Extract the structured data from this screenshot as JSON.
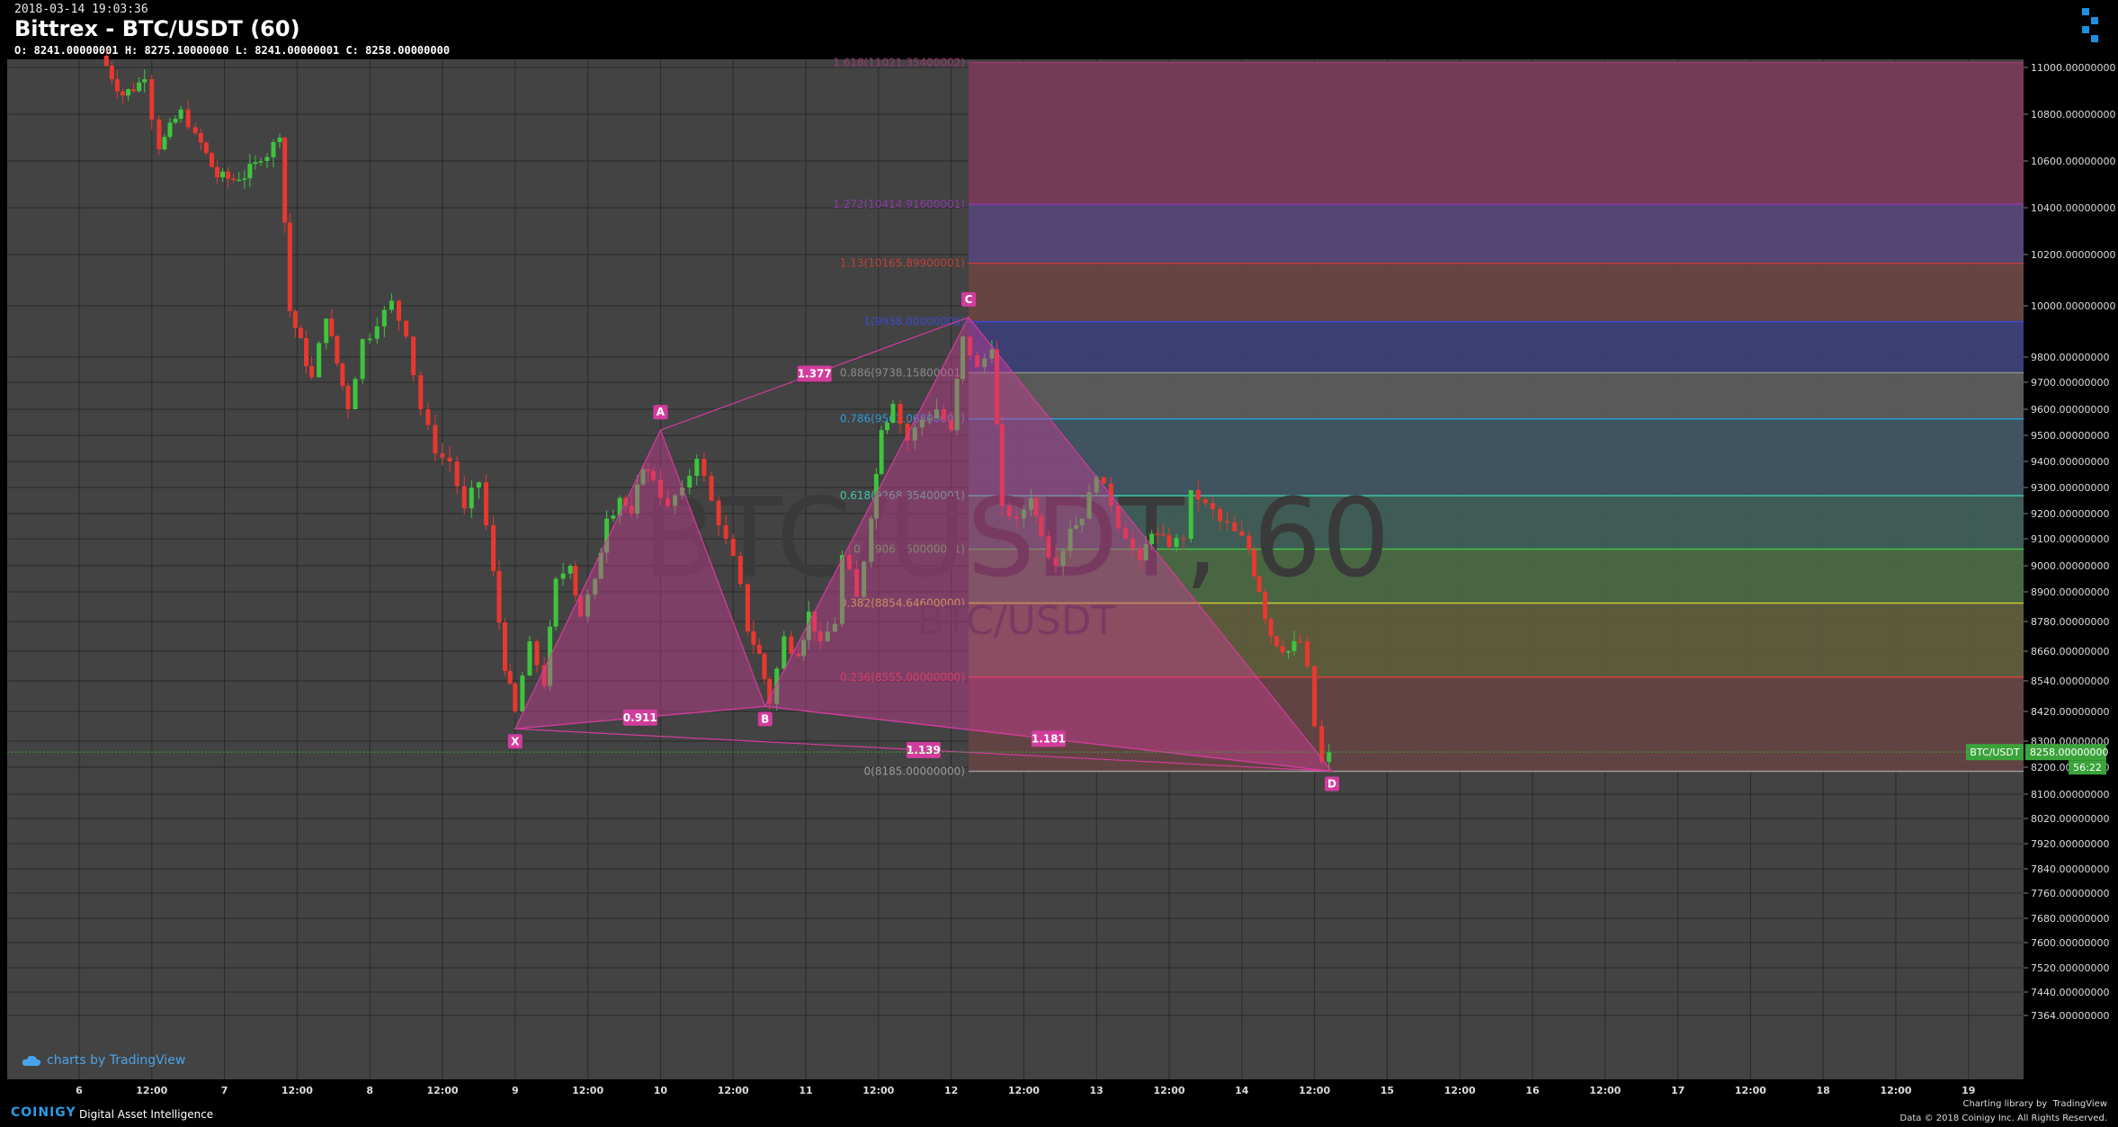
{
  "header": {
    "timestamp": "2018-03-14 19:03:36",
    "title": "Bittrex - BTC/USDT (60)",
    "ohlc": "O: 8241.00000001 H: 8275.10000000 L: 8241.00000001 C: 8258.00000000"
  },
  "watermark": {
    "main": "BTC/USDT, 60",
    "sub": "BTC/USDT"
  },
  "footer": {
    "brand": "COINIGY",
    "tagline": "Digital Asset Intelligence",
    "charting_by": "Charting library by",
    "tradingview": "TradingView",
    "copyright": "Data © 2018  Coinigy Inc. All Rights Reserved."
  },
  "tv_badge": "charts by TradingView",
  "colors": {
    "background": "#434343",
    "grid": "#2a2a2a",
    "up": "#3ec43e",
    "down": "#e8382f",
    "pattern": "#d23c9c",
    "price_tag": "#3aa33a"
  },
  "chart_data": {
    "type": "candlestick",
    "symbol": "BTC/USDT",
    "interval": "60",
    "ylim": [
      7300,
      11050
    ],
    "y_ticks": [
      11000,
      10800,
      10600,
      10400,
      10200,
      10000,
      9800,
      9700,
      9600,
      9500,
      9400,
      9300,
      9200,
      9100,
      9000,
      8900,
      8780,
      8660,
      8540,
      8420,
      8300,
      8200,
      8100,
      8020,
      7920,
      7840,
      7760,
      7680,
      7600,
      7520,
      7440,
      7364
    ],
    "y_tick_labels": [
      "11000.00000000",
      "10800.00000000",
      "10600.00000000",
      "10400.00000000",
      "10200.00000000",
      "10000.00000000",
      "9800.00000000",
      "9700.00000000",
      "9600.00000000",
      "9500.00000000",
      "9400.00000000",
      "9300.00000000",
      "9200.00000000",
      "9100.00000000",
      "9000.00000000",
      "8900.00000000",
      "8780.00000000",
      "8660.00000000",
      "8540.00000000",
      "8420.00000000",
      "8300.00000000",
      "8200.00000000",
      "8100.00000000",
      "8020.00000000",
      "7920.00000000",
      "7840.00000000",
      "7760.00000000",
      "7680.00000000",
      "7600.00000000",
      "7520.00000000",
      "7440.00000000",
      "7364.00000000"
    ],
    "x_ticks": [
      {
        "t": 6.0,
        "label": "6"
      },
      {
        "t": 6.5,
        "label": "12:00"
      },
      {
        "t": 7.0,
        "label": "7"
      },
      {
        "t": 7.5,
        "label": "12:00"
      },
      {
        "t": 8.0,
        "label": "8"
      },
      {
        "t": 8.5,
        "label": "12:00"
      },
      {
        "t": 9.0,
        "label": "9"
      },
      {
        "t": 9.5,
        "label": "12:00"
      },
      {
        "t": 10.0,
        "label": "10"
      },
      {
        "t": 10.5,
        "label": "12:00"
      },
      {
        "t": 11.0,
        "label": "11"
      },
      {
        "t": 11.5,
        "label": "12:00"
      },
      {
        "t": 12.0,
        "label": "12"
      },
      {
        "t": 12.5,
        "label": "12:00"
      },
      {
        "t": 13.0,
        "label": "13"
      },
      {
        "t": 13.5,
        "label": "12:00"
      },
      {
        "t": 14.0,
        "label": "14"
      },
      {
        "t": 14.5,
        "label": "12:00"
      },
      {
        "t": 15.0,
        "label": "15"
      },
      {
        "t": 15.5,
        "label": "12:00"
      },
      {
        "t": 16.0,
        "label": "16"
      },
      {
        "t": 16.5,
        "label": "12:00"
      },
      {
        "t": 17.0,
        "label": "17"
      },
      {
        "t": 17.5,
        "label": "12:00"
      },
      {
        "t": 18.0,
        "label": "18"
      },
      {
        "t": 18.5,
        "label": "12:00"
      },
      {
        "t": 19.0,
        "label": "19"
      }
    ],
    "xlim": [
      5.55,
      19.35
    ],
    "price_path": [
      [
        6.15,
        11050
      ],
      [
        6.3,
        10880
      ],
      [
        6.45,
        10950
      ],
      [
        6.55,
        10650
      ],
      [
        6.7,
        10820
      ],
      [
        6.8,
        10720
      ],
      [
        6.95,
        10530
      ],
      [
        7.1,
        10520
      ],
      [
        7.25,
        10600
      ],
      [
        7.38,
        10700
      ],
      [
        7.45,
        9980
      ],
      [
        7.6,
        9720
      ],
      [
        7.7,
        9950
      ],
      [
        7.85,
        9600
      ],
      [
        7.95,
        9870
      ],
      [
        8.05,
        9920
      ],
      [
        8.15,
        10020
      ],
      [
        8.25,
        9880
      ],
      [
        8.35,
        9600
      ],
      [
        8.45,
        9430
      ],
      [
        8.55,
        9400
      ],
      [
        8.65,
        9220
      ],
      [
        8.75,
        9320
      ],
      [
        8.85,
        8980
      ],
      [
        8.93,
        8580
      ],
      [
        9.0,
        8420
      ],
      [
        9.1,
        8700
      ],
      [
        9.2,
        8520
      ],
      [
        9.28,
        8950
      ],
      [
        9.38,
        9000
      ],
      [
        9.45,
        8800
      ],
      [
        9.55,
        8950
      ],
      [
        9.63,
        9180
      ],
      [
        9.72,
        9260
      ],
      [
        9.8,
        9200
      ],
      [
        9.88,
        9370
      ],
      [
        9.95,
        9330
      ],
      [
        10.05,
        9230
      ],
      [
        10.15,
        9300
      ],
      [
        10.25,
        9410
      ],
      [
        10.35,
        9250
      ],
      [
        10.45,
        9100
      ],
      [
        10.55,
        8930
      ],
      [
        10.6,
        8740
      ],
      [
        10.68,
        8650
      ],
      [
        10.75,
        8450
      ],
      [
        10.85,
        8720
      ],
      [
        10.95,
        8640
      ],
      [
        11.02,
        8820
      ],
      [
        11.1,
        8700
      ],
      [
        11.2,
        8770
      ],
      [
        11.25,
        9040
      ],
      [
        11.35,
        8880
      ],
      [
        11.45,
        9180
      ],
      [
        11.52,
        9520
      ],
      [
        11.6,
        9620
      ],
      [
        11.7,
        9480
      ],
      [
        11.8,
        9560
      ],
      [
        11.9,
        9600
      ],
      [
        12.0,
        9520
      ],
      [
        12.08,
        9880
      ],
      [
        12.18,
        9760
      ],
      [
        12.28,
        9830
      ],
      [
        12.35,
        9230
      ],
      [
        12.45,
        9180
      ],
      [
        12.55,
        9260
      ],
      [
        12.62,
        9110
      ],
      [
        12.72,
        9000
      ],
      [
        12.82,
        9140
      ],
      [
        12.9,
        9180
      ],
      [
        13.0,
        9340
      ],
      [
        13.1,
        9230
      ],
      [
        13.2,
        9100
      ],
      [
        13.3,
        9020
      ],
      [
        13.38,
        9120
      ],
      [
        13.5,
        9070
      ],
      [
        13.6,
        9100
      ],
      [
        13.65,
        9290
      ],
      [
        13.75,
        9240
      ],
      [
        13.85,
        9170
      ],
      [
        13.95,
        9130
      ],
      [
        14.05,
        9060
      ],
      [
        14.12,
        8900
      ],
      [
        14.2,
        8720
      ],
      [
        14.32,
        8660
      ],
      [
        14.4,
        8700
      ],
      [
        14.45,
        8600
      ],
      [
        14.5,
        8360
      ],
      [
        14.55,
        8220
      ],
      [
        14.6,
        8258
      ]
    ],
    "pattern": {
      "name": "XABCD",
      "points": {
        "X": {
          "t": 9.0,
          "price": 8350,
          "label": "X"
        },
        "A": {
          "t": 10.0,
          "price": 9520,
          "label": "A"
        },
        "B": {
          "t": 10.72,
          "price": 8440,
          "label": "B"
        },
        "C": {
          "t": 12.12,
          "price": 9955,
          "label": "C"
        },
        "D": {
          "t": 14.62,
          "price": 8185,
          "label": "D"
        }
      },
      "ratios": [
        {
          "from": "X",
          "to": "B",
          "label": "0.911"
        },
        {
          "from": "A",
          "to": "C",
          "label": "1.377"
        },
        {
          "from": "X",
          "to": "D",
          "label": "1.139"
        },
        {
          "from": "B",
          "to": "D",
          "label": "1.181"
        }
      ]
    },
    "fib_levels": [
      {
        "level": 1.618,
        "price": 11021.354,
        "label": "1.618(11021.35400002)",
        "color": "#9a3a6e",
        "band": "#7a3b5a"
      },
      {
        "level": 1.272,
        "price": 10414.916,
        "label": "1.272(10414.91600001)",
        "color": "#8a3aa8",
        "band": "#55477a"
      },
      {
        "level": 1.13,
        "price": 10165.899,
        "label": "1.13(10165.89900001)",
        "color": "#c0403a",
        "band": "#6a4540"
      },
      {
        "level": 1.0,
        "price": 9938.0,
        "label": "1(9938.00000000)",
        "color": "#3a4ad0",
        "band": "#3b3f7a"
      },
      {
        "level": 0.886,
        "price": 9738.158,
        "label": "0.886(9738.15800001)",
        "color": "#8a8a8a",
        "band": "#5c5c5c"
      },
      {
        "level": 0.786,
        "price": 9563.0,
        "label": "0.786(9563.06800001)",
        "color": "#2e9ad6",
        "band": "#3f5564"
      },
      {
        "level": 0.618,
        "price": 9268.354,
        "label": "0.618(9268.35400001)",
        "color": "#3cc8a8",
        "band": "#3e5f58"
      },
      {
        "level": 0.5,
        "price": 9061.5,
        "label": "0.5(9061.50000001)",
        "color": "#44c044",
        "band": "#4a6a44"
      },
      {
        "level": 0.382,
        "price": 8854.646,
        "label": "0.382(8854.64600000)",
        "color": "#c8c832",
        "band": "#5e5e3c"
      },
      {
        "level": 0.236,
        "price": 8555.0,
        "label": "0.236(8555.00000000)",
        "color": "#d8403a",
        "band": "#664444"
      },
      {
        "level": 0.0,
        "price": 8185.0,
        "label": "0(8185.00000000)",
        "color": "#9a9a9a",
        "band": ""
      }
    ],
    "fib_start_t": 12.12,
    "last_price": {
      "label": "BTC/USDT",
      "price": 8258.0,
      "price_label": "8258.00000000",
      "countdown": "56:22"
    }
  }
}
